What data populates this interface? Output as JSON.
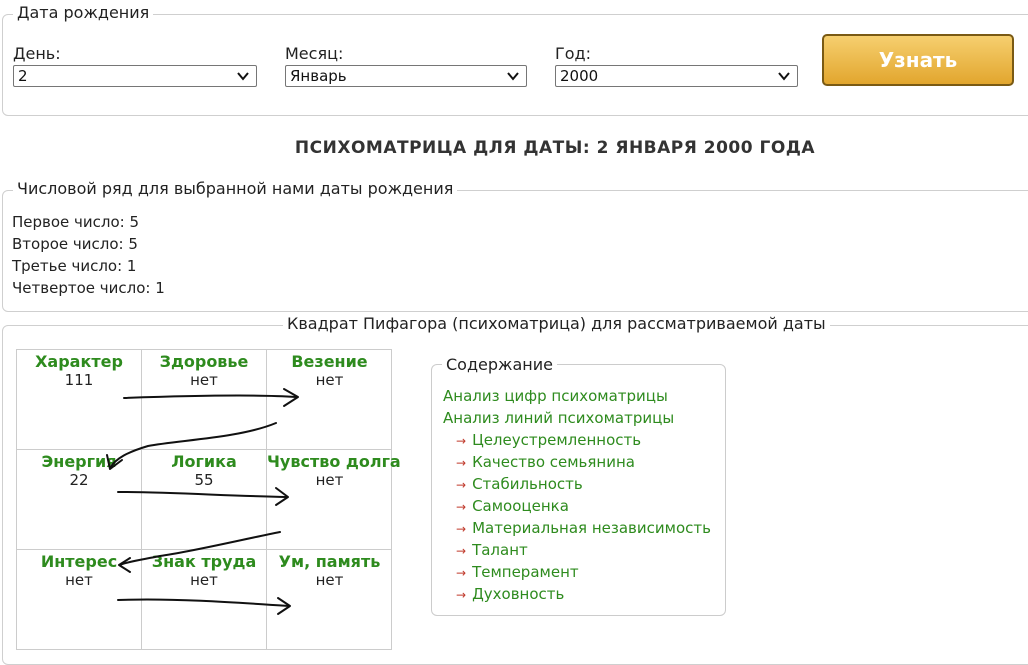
{
  "birth_form": {
    "legend": "Дата рождения",
    "day_label": "День:",
    "day_value": "2",
    "month_label": "Месяц:",
    "month_value": "Январь",
    "year_label": "Год:",
    "year_value": "2000",
    "submit_label": "Узнать"
  },
  "page_title": "ПСИХОМАТРИЦА ДЛЯ ДАТЫ: 2 ЯНВАРЯ 2000 ГОДА",
  "number_series": {
    "legend": "Числовой ряд для выбранной нами даты рождения",
    "lines": [
      "Первое число: 5",
      "Второе число: 5",
      "Третье число: 1",
      "Четвертое число: 1"
    ]
  },
  "psychomatrix": {
    "legend": "Квадрат Пифагора (психоматрица) для рассматриваемой даты",
    "cells": [
      {
        "name": "Характер",
        "value": "111"
      },
      {
        "name": "Здоровье",
        "value": "нет"
      },
      {
        "name": "Везение",
        "value": "нет"
      },
      {
        "name": "Энергия",
        "value": "22"
      },
      {
        "name": "Логика",
        "value": "55"
      },
      {
        "name": "Чувство долга",
        "value": "нет"
      },
      {
        "name": "Интерес",
        "value": "нет"
      },
      {
        "name": "Знак труда",
        "value": "нет"
      },
      {
        "name": "Ум, память",
        "value": "нет"
      }
    ]
  },
  "contents": {
    "legend": "Содержание",
    "links": [
      "Анализ цифр психоматрицы",
      "Анализ линий психоматрицы"
    ],
    "sublinks": [
      "Целеустремленность",
      "Качество семьянина",
      "Стабильность",
      "Самооценка",
      "Материальная независимость",
      "Талант",
      "Темперамент",
      "Духовность"
    ]
  },
  "colors": {
    "accent_green": "#2e8b1e",
    "button_gold": "#e2a62e",
    "sub_arrow": "#c0392b",
    "annotation_ink": "#111111"
  }
}
